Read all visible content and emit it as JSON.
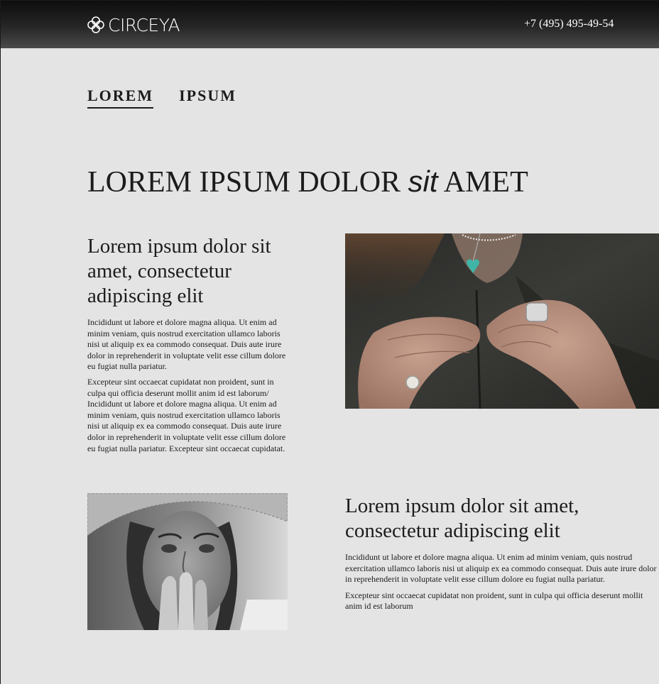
{
  "header": {
    "brand": "CIRCEYA",
    "phone": "+7 (495) 495-49-54",
    "logo_icon": "quatrefoil-icon"
  },
  "tabs": [
    {
      "label": "LOREM",
      "active": true
    },
    {
      "label": "IPSUM",
      "active": false
    }
  ],
  "title": {
    "before": "LOREM IPSUM DOLOR",
    "italic": "sit",
    "after": "AMET"
  },
  "section1": {
    "heading": "Lorem ipsum dolor sit amet, consectetur adipiscing elit",
    "paragraphs": [
      "Incididunt ut labore et dolore magna aliqua. Ut enim ad minim veniam, quis nostrud exercitation ullamco laboris nisi ut aliquip ex ea commodo consequat. Duis aute irure dolor in reprehenderit in voluptate velit esse cillum dolore eu fugiat nulla pariatur.",
      "Excepteur sint occaecat cupidatat non proident, sunt in culpa qui officia deserunt mollit anim id est laborum/ Incididunt ut labore et dolore magna aliqua. Ut enim ad minim veniam, quis nostrud exercitation ullamco laboris nisi ut aliquip ex ea commodo consequat. Duis aute irure dolor in reprehenderit in voluptate velit esse cillum dolore eu fugiat nulla pariatur. Excepteur sint occaecat cupidatat."
    ]
  },
  "section2": {
    "heading": "Lorem ipsum dolor sit amet, consectetur adipiscing elit",
    "paragraphs": [
      "Incididunt ut labore et dolore magna aliqua. Ut enim ad minim veniam, quis nostrud exercitation ullamco laboris nisi ut aliquip ex ea commodo consequat. Duis aute irure dolor in reprehenderit in voluptate velit esse cillum dolore eu fugiat nulla pariatur.",
      "Excepteur sint occaecat cupidatat non proident, sunt in culpa qui officia deserunt mollit anim id est laborum"
    ]
  },
  "colors": {
    "background": "#e4e4e4",
    "header_dark": "#0d0d0d",
    "text": "#1c1c1c",
    "turquoise": "#3fb5a8"
  }
}
